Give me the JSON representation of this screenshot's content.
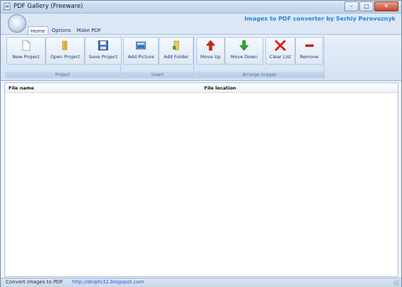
{
  "window": {
    "title": "PDF Gallery (Freeware)",
    "buttons": {
      "minimize": "–",
      "maximize": "□",
      "close": "✕"
    }
  },
  "ribbon": {
    "tabs": [
      "Home",
      "Options",
      "Make PDF"
    ],
    "active_tab": "Home",
    "brand_text": "Images to PDF converter by Serhiy Perevoznyk",
    "groups": [
      {
        "label": "Project",
        "buttons": [
          {
            "label": "New Project",
            "icon": "new-document-icon"
          },
          {
            "label": "Open Project",
            "icon": "open-folder-icon"
          },
          {
            "label": "Save Project",
            "icon": "floppy-disk-icon"
          }
        ]
      },
      {
        "label": "Insert",
        "buttons": [
          {
            "label": "Add Picture",
            "icon": "picture-icon"
          },
          {
            "label": "Add Folder",
            "icon": "add-folder-icon"
          }
        ]
      },
      {
        "label": "Arrange images",
        "buttons": [
          {
            "label": "Move Up",
            "icon": "arrow-up-icon"
          },
          {
            "label": "Move Down",
            "icon": "arrow-down-icon"
          },
          {
            "label": "Clear List",
            "icon": "red-x-icon"
          },
          {
            "label": "Remove",
            "icon": "minus-icon"
          }
        ]
      }
    ]
  },
  "list": {
    "columns": [
      "File name",
      "File location"
    ],
    "rows": []
  },
  "statusbar": {
    "text": "Convert images to PDF",
    "link": "http://delphi32.blogspot.com"
  },
  "colors": {
    "brand_text": "#2a86d6",
    "arrow_up": "#d12a1e",
    "arrow_down": "#2fa82a",
    "clear_x": "#d82020",
    "remove": "#c0281e"
  }
}
